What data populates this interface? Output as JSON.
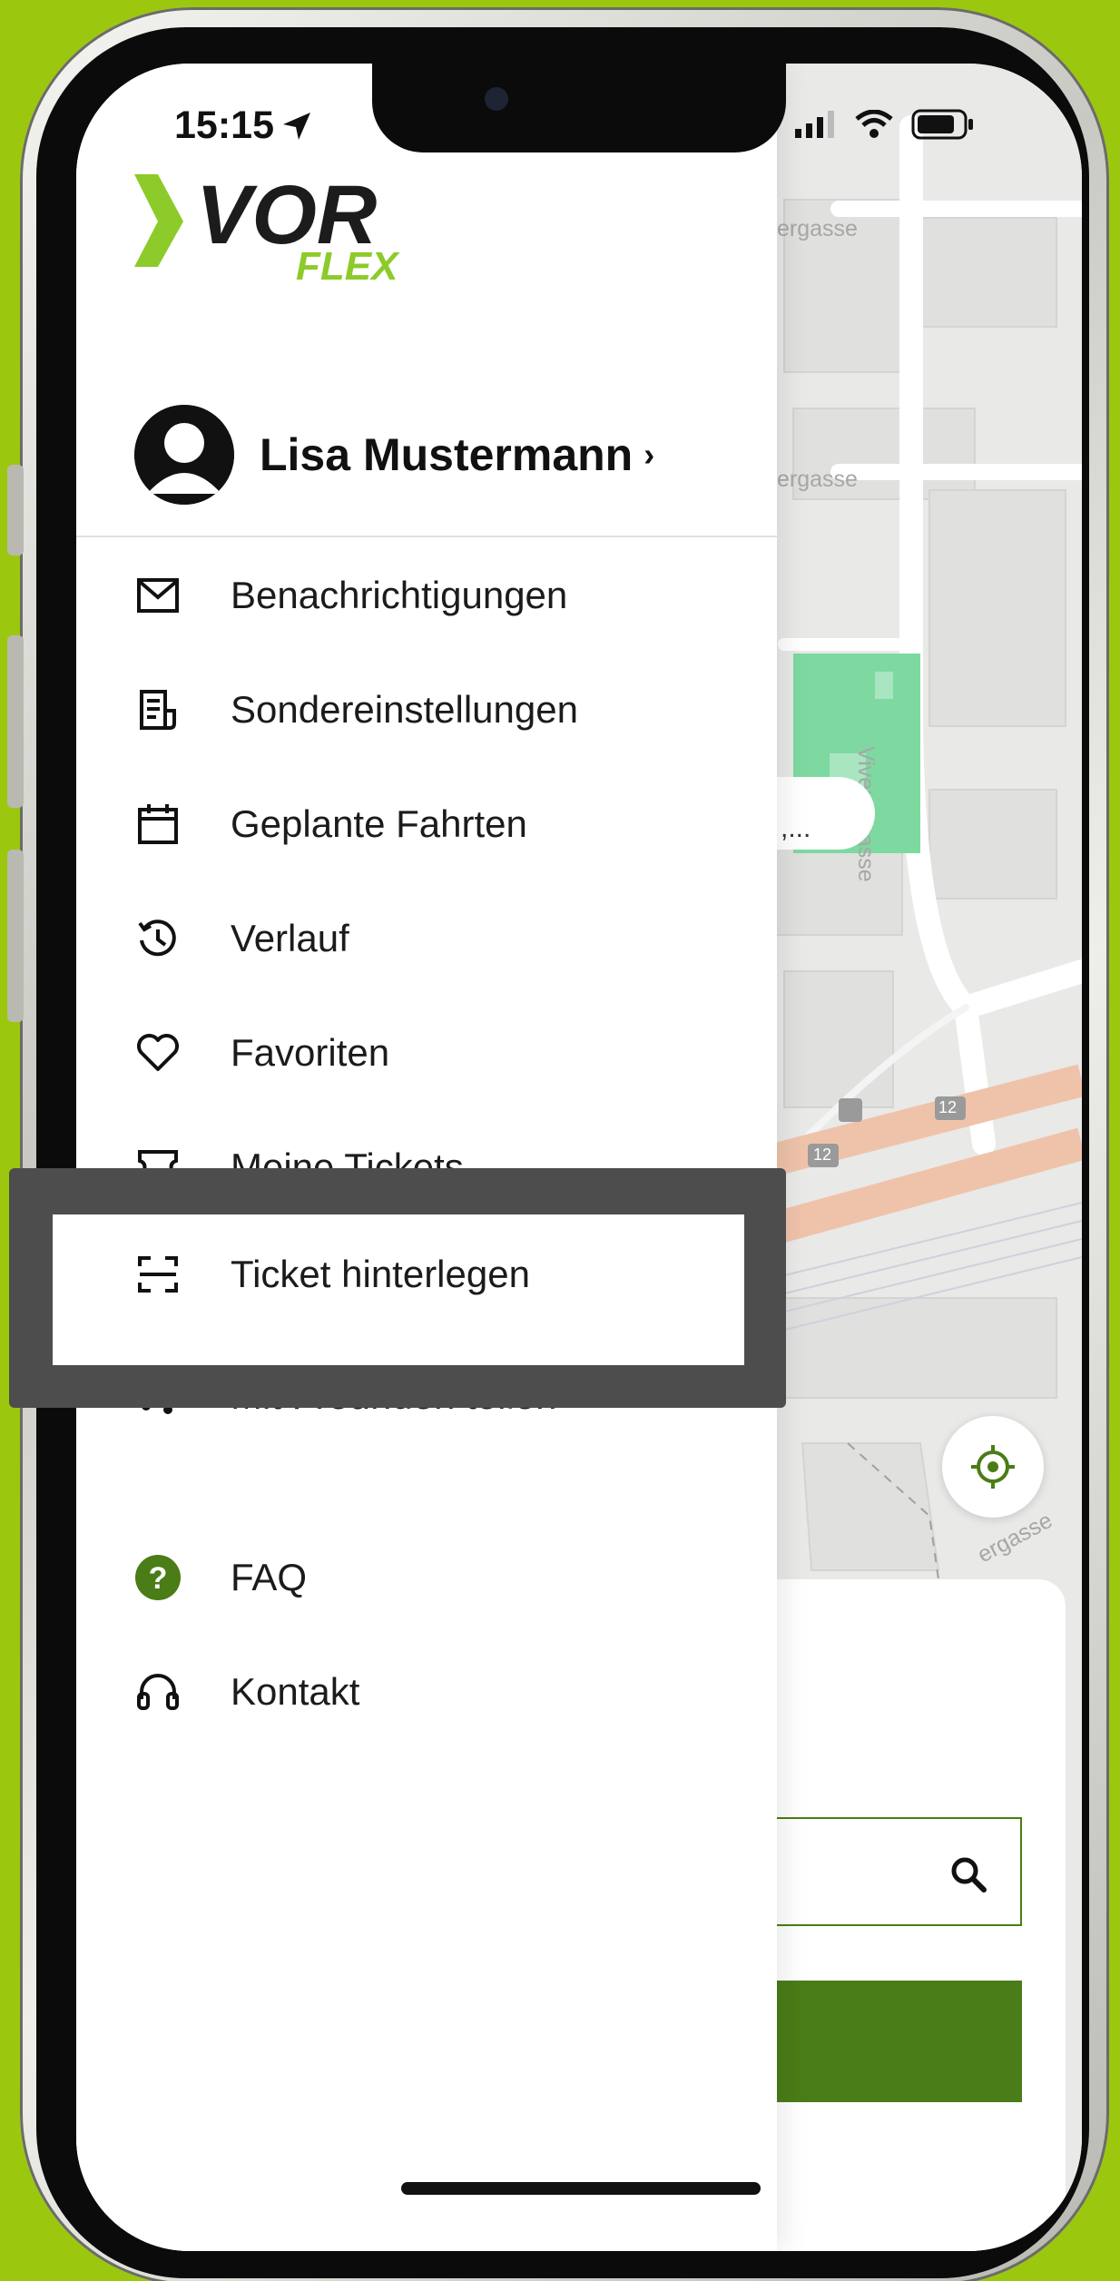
{
  "status_bar": {
    "time": "15:15"
  },
  "logo": {
    "main": "VOR",
    "sub": "FLEX"
  },
  "profile": {
    "name": "Lisa Mustermann",
    "chevron": "›"
  },
  "menu": {
    "items": [
      {
        "label": "Benachrichtigungen",
        "icon": "envelope-icon"
      },
      {
        "label": "Sondereinstellungen",
        "icon": "settings-list-icon"
      },
      {
        "label": "Geplante Fahrten",
        "icon": "calendar-icon"
      },
      {
        "label": "Verlauf",
        "icon": "history-icon"
      },
      {
        "label": "Favoriten",
        "icon": "heart-icon"
      },
      {
        "label": "Meine Tickets",
        "icon": "ticket-icon"
      },
      {
        "label": "Ticket hinterlegen",
        "icon": "scan-icon"
      },
      {
        "label": "Mit Freunden teilen",
        "icon": "share-icon"
      },
      {
        "label": "FAQ",
        "icon": "help-icon"
      },
      {
        "label": "Kontakt",
        "icon": "headset-icon"
      }
    ]
  },
  "map": {
    "streets": [
      "ergasse",
      "ergasse",
      "Vivenotgasse",
      "ergasse"
    ],
    "route_badges": [
      "12",
      "12"
    ],
    "chip_text": ",..."
  },
  "colors": {
    "background": "#9bc80f",
    "brand_green": "#4a7c17",
    "logo_green": "#8ccb2a",
    "highlight": "#4d4d4d",
    "park": "#7dd9a0",
    "tram_line": "#efc3aa"
  }
}
